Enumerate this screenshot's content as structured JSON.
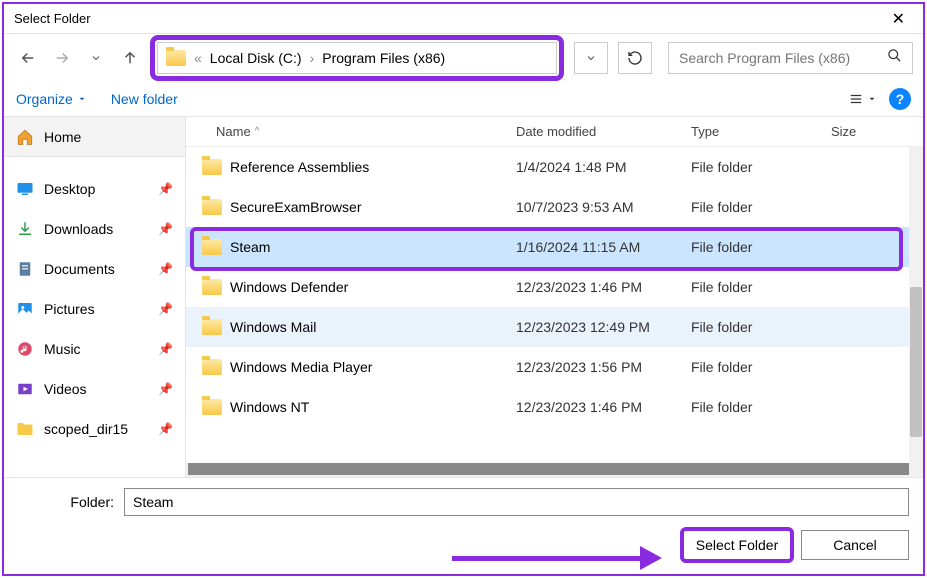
{
  "title": "Select Folder",
  "breadcrumb": {
    "root": "Local Disk (C:)",
    "path": "Program Files (x86)",
    "prefix": "«"
  },
  "search": {
    "placeholder": "Search Program Files (x86)"
  },
  "toolbar": {
    "organize": "Organize",
    "newfolder": "New folder"
  },
  "sidebar": {
    "home": "Home",
    "items": [
      {
        "label": "Desktop"
      },
      {
        "label": "Downloads"
      },
      {
        "label": "Documents"
      },
      {
        "label": "Pictures"
      },
      {
        "label": "Music"
      },
      {
        "label": "Videos"
      },
      {
        "label": "scoped_dir15"
      }
    ]
  },
  "columns": {
    "name": "Name",
    "date": "Date modified",
    "type": "Type",
    "size": "Size"
  },
  "files": [
    {
      "name": "Reference Assemblies",
      "date": "1/4/2024 1:48 PM",
      "type": "File folder"
    },
    {
      "name": "SecureExamBrowser",
      "date": "10/7/2023 9:53 AM",
      "type": "File folder"
    },
    {
      "name": "Steam",
      "date": "1/16/2024 11:15 AM",
      "type": "File folder"
    },
    {
      "name": "Windows Defender",
      "date": "12/23/2023 1:46 PM",
      "type": "File folder"
    },
    {
      "name": "Windows Mail",
      "date": "12/23/2023 12:49 PM",
      "type": "File folder"
    },
    {
      "name": "Windows Media Player",
      "date": "12/23/2023 1:56 PM",
      "type": "File folder"
    },
    {
      "name": "Windows NT",
      "date": "12/23/2023 1:46 PM",
      "type": "File folder"
    }
  ],
  "selected_index": 2,
  "hover_index": 4,
  "folder_label": "Folder:",
  "folder_value": "Steam",
  "buttons": {
    "select": "Select Folder",
    "cancel": "Cancel"
  }
}
